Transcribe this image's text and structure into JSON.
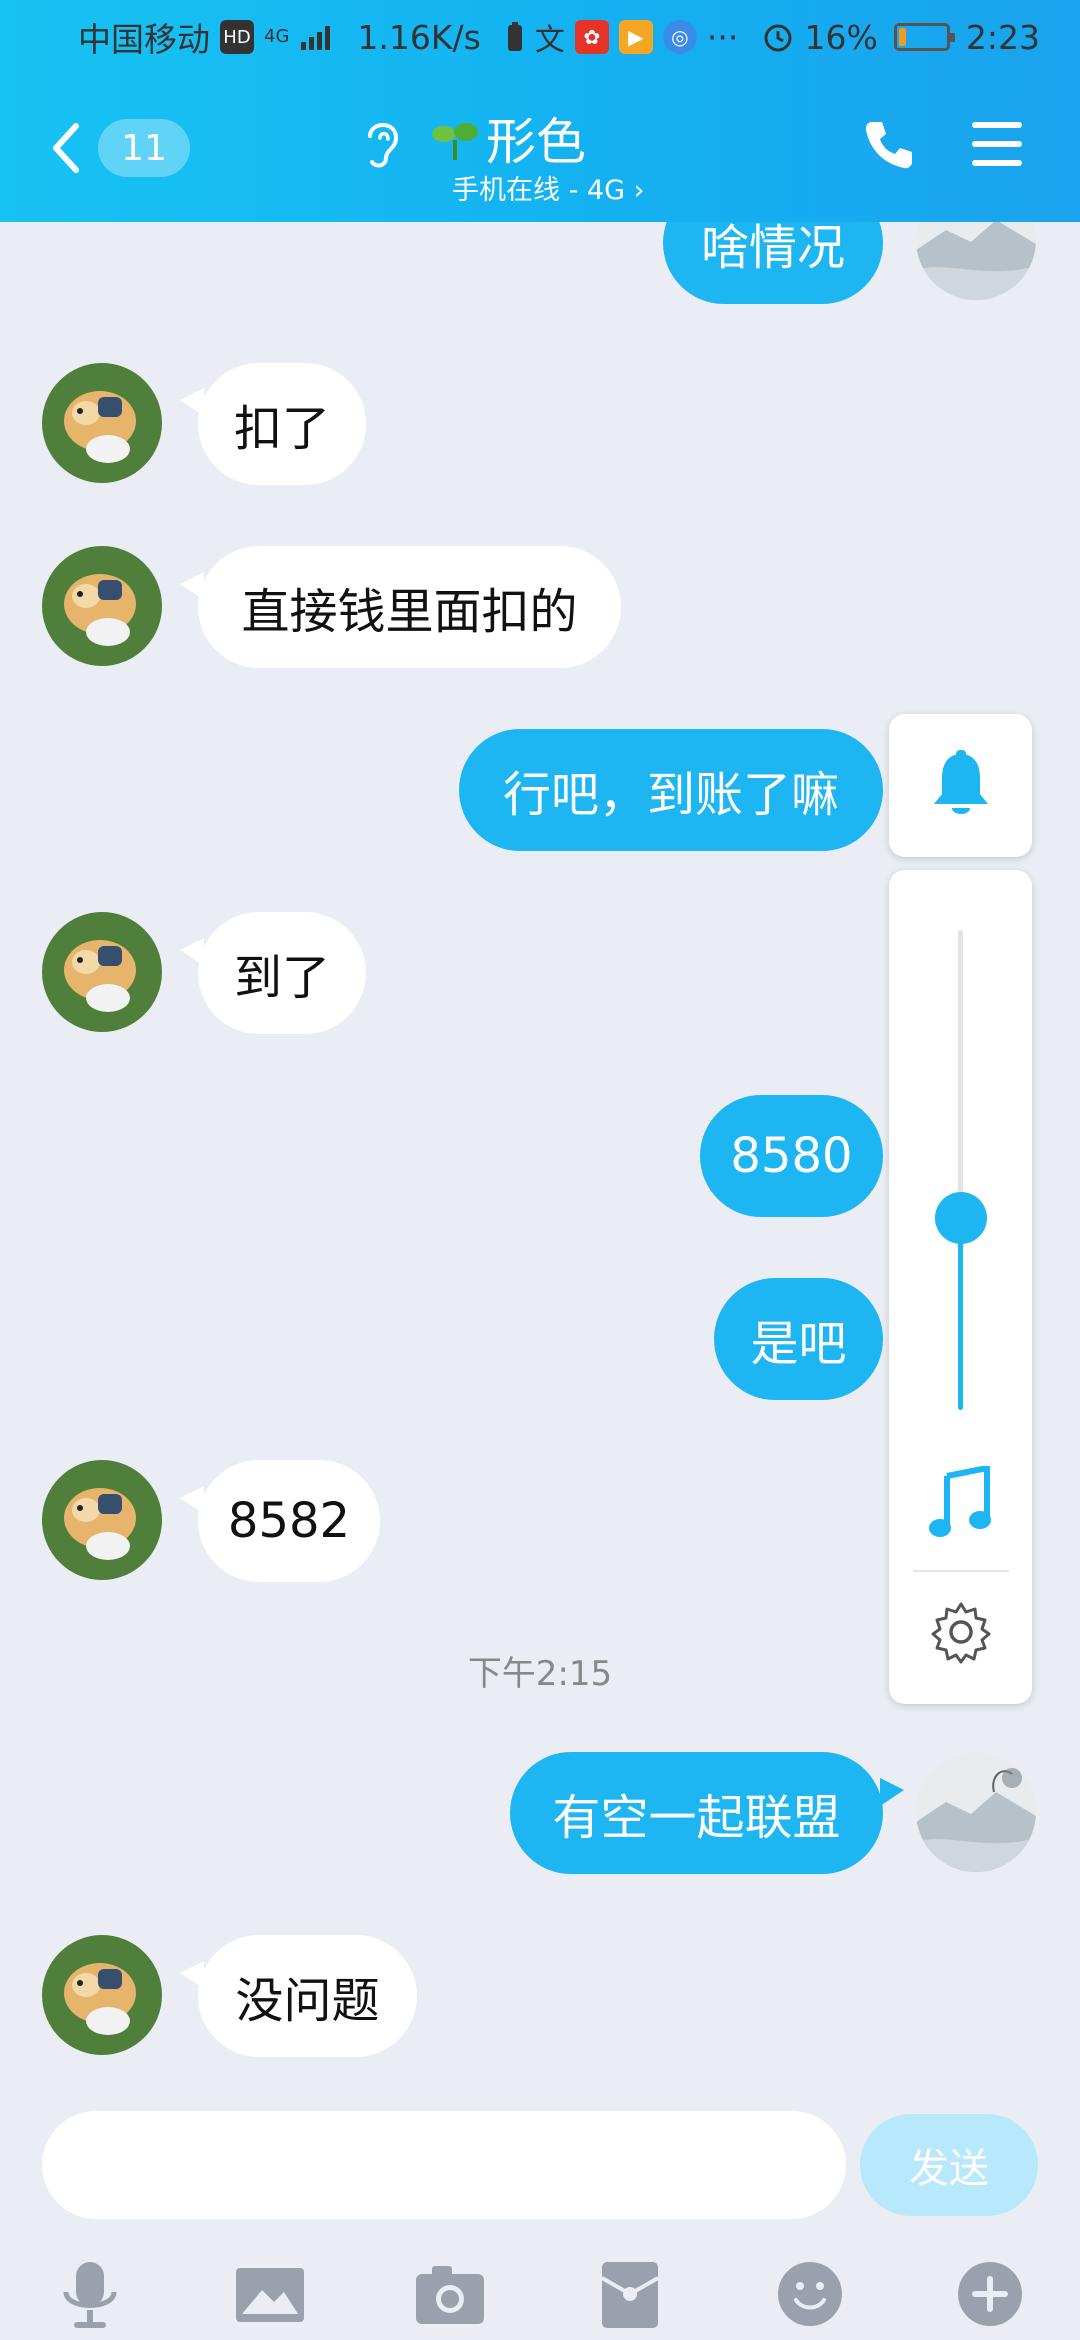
{
  "status_bar": {
    "carrier": "中国移动",
    "hd": "HD",
    "network": "4G",
    "speed": "1.16K/s",
    "more": "···",
    "battery_percent": "16%",
    "battery_level": 0.16,
    "time": "2:23"
  },
  "header": {
    "back_icon": "chevron-left-icon",
    "unread_count": "11",
    "contact_name": "形色",
    "online_status": "手机在线 - 4G ›",
    "accent_color": "#14b1f1"
  },
  "messages": [
    {
      "direction": "out",
      "text": "啥情况"
    },
    {
      "direction": "in",
      "text": "扣了"
    },
    {
      "direction": "in",
      "text": "直接钱里面扣的"
    },
    {
      "direction": "out",
      "text": "行吧，到账了嘛"
    },
    {
      "direction": "in",
      "text": "到了"
    },
    {
      "direction": "out",
      "text": "8580"
    },
    {
      "direction": "out",
      "text": "是吧"
    },
    {
      "direction": "in",
      "text": "8582"
    },
    {
      "direction": "in",
      "text": "没问题"
    },
    {
      "direction": "out",
      "text": "有空一起联盟"
    }
  ],
  "time_separator": "下午2:15",
  "volume_popup": {
    "level": 0.4,
    "icons": [
      "bell-icon",
      "music-note-icon",
      "gear-icon"
    ]
  },
  "input_bar": {
    "placeholder": "",
    "send_label": "发送",
    "tools": [
      "microphone-icon",
      "image-icon",
      "camera-icon",
      "red-packet-icon",
      "emoji-icon",
      "plus-icon"
    ]
  }
}
